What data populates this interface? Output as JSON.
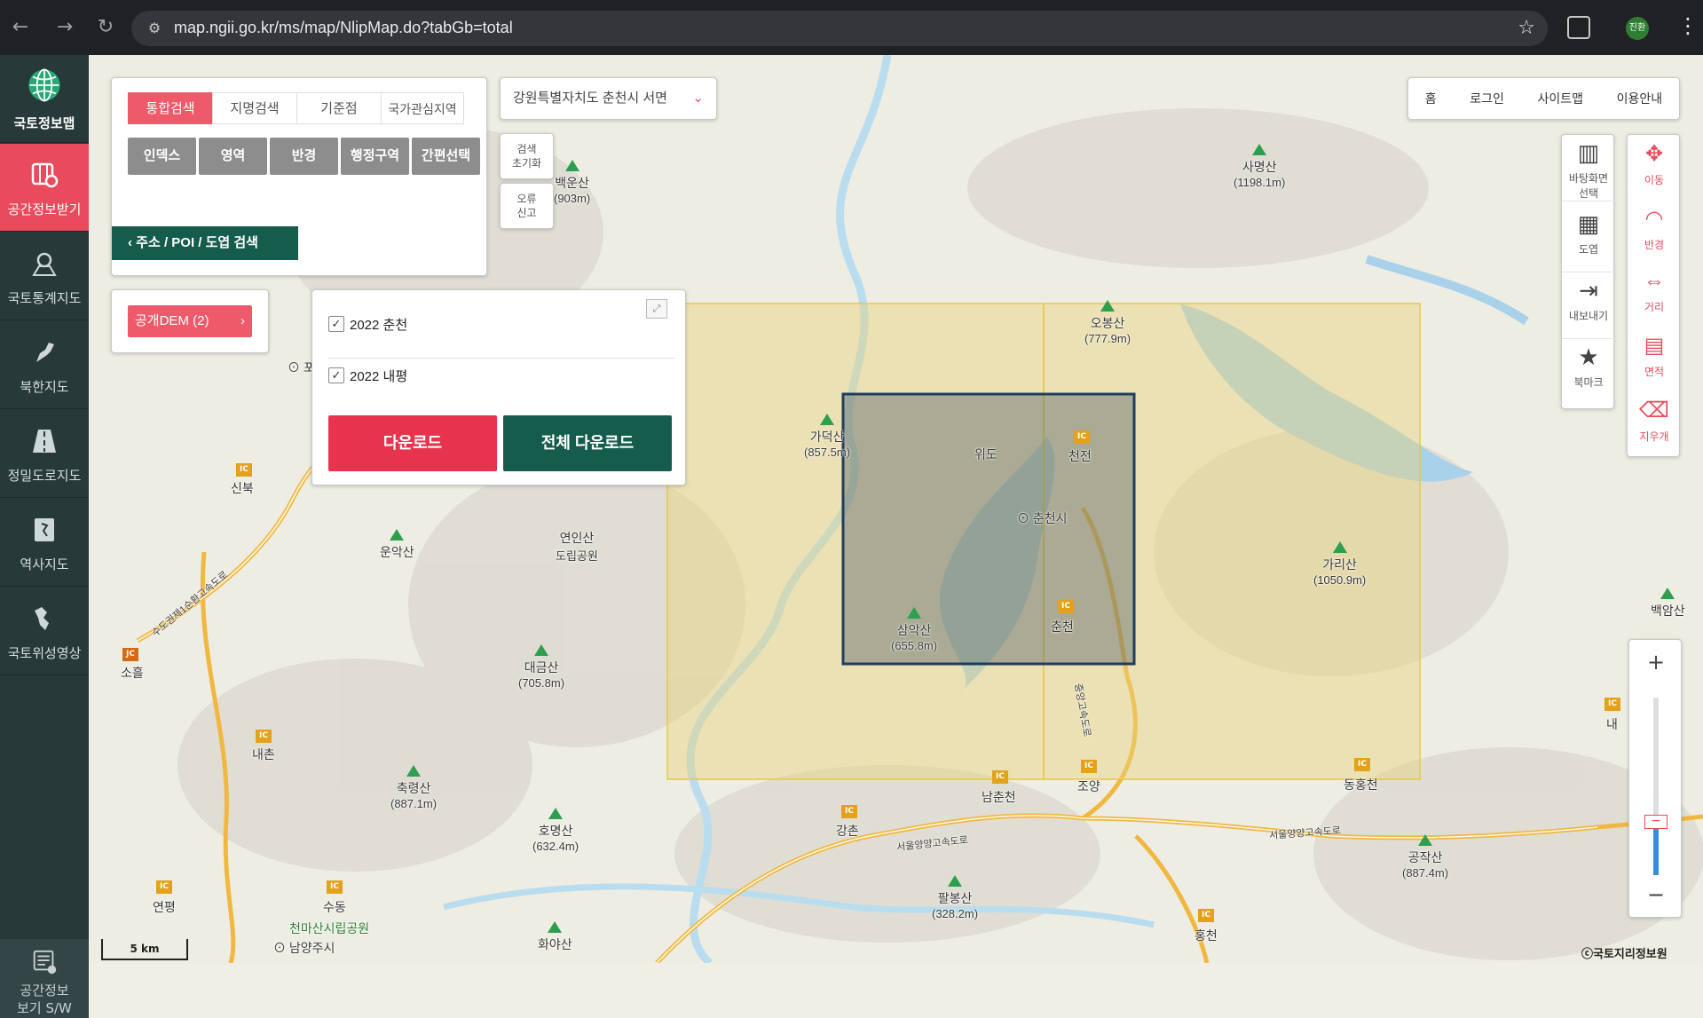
{
  "browser": {
    "url": "map.ngii.go.kr/ms/map/NlipMap.do?tabGb=total",
    "profile_initials": "진환"
  },
  "sidebar": {
    "items": [
      {
        "label": "국토정보맵",
        "icon": "globe-icon"
      },
      {
        "label": "공간정보받기",
        "icon": "map-download-icon"
      },
      {
        "label": "국토통계지도",
        "icon": "stat-map-icon"
      },
      {
        "label": "북한지도",
        "icon": "north-korea-icon"
      },
      {
        "label": "정밀도로지도",
        "icon": "road-icon"
      },
      {
        "label": "역사지도",
        "icon": "history-map-icon"
      },
      {
        "label": "국토위성영상",
        "icon": "satellite-icon"
      }
    ],
    "bottom": {
      "label_line1": "공간정보",
      "label_line2": "보기 S/W"
    }
  },
  "search_panel": {
    "tabs": [
      "통합검색",
      "지명검색",
      "기준점",
      "국가관심지역"
    ],
    "tools": [
      "인덱스",
      "영역",
      "반경",
      "행정구역",
      "간편선택"
    ],
    "address_search": "주소 / POI / 도엽 검색"
  },
  "dem": {
    "label": "공개DEM (2)"
  },
  "download_panel": {
    "items": [
      {
        "label": "2022 춘천",
        "checked": true
      },
      {
        "label": "2022 내평",
        "checked": true
      }
    ],
    "download_label": "다운로드",
    "download_all_label": "전체 다운로드"
  },
  "region_select": {
    "value": "강원특별자치도 춘천시 서면"
  },
  "small_buttons": {
    "reset": {
      "line1": "검색",
      "line2": "초기화"
    },
    "report": {
      "line1": "오류",
      "line2": "신고"
    }
  },
  "top_links": [
    "홈",
    "로그인",
    "사이트맵",
    "이용안내"
  ],
  "map_tools": [
    {
      "line1": "바탕화면",
      "line2": "선택",
      "icon": "basemap-icon"
    },
    {
      "line1": "도엽",
      "line2": "",
      "icon": "grid-icon"
    },
    {
      "line1": "내보내기",
      "line2": "",
      "icon": "export-icon"
    },
    {
      "line1": "북마크",
      "line2": "",
      "icon": "star-icon"
    }
  ],
  "measure_tools": [
    {
      "label": "이동",
      "icon": "move-icon"
    },
    {
      "label": "반경",
      "icon": "radius-icon"
    },
    {
      "label": "거리",
      "icon": "distance-icon"
    },
    {
      "label": "면적",
      "icon": "area-icon"
    },
    {
      "label": "지우개",
      "icon": "eraser-icon"
    }
  ],
  "zoom": {
    "plus": "+",
    "minus": "−",
    "level_fraction": 0.3
  },
  "map": {
    "scale_label": "5 km",
    "copyright": "ⓒ국토지리정보원",
    "places": [
      {
        "name": "백운산",
        "sub": "(903m)",
        "mtn": true
      },
      {
        "name": "사명산",
        "sub": "(1198.1m)",
        "mtn": true
      },
      {
        "name": "오봉산",
        "sub": "(777.9m)",
        "mtn": true
      },
      {
        "name": "가덕산",
        "sub": "(857.5m)",
        "mtn": true
      },
      {
        "name": "위도",
        "sub": "",
        "mtn": false
      },
      {
        "name": "천전",
        "sub": "",
        "mtn": false
      },
      {
        "name": "춘천시",
        "sub": "",
        "mtn": false
      },
      {
        "name": "가리산",
        "sub": "(1050.9m)",
        "mtn": true
      },
      {
        "name": "신북",
        "sub": "",
        "mtn": false
      },
      {
        "name": "운악산",
        "sub": "",
        "mtn": true
      },
      {
        "name": "연인산",
        "sub": "도립공원",
        "mtn": false
      },
      {
        "name": "삼악산",
        "sub": "(655.8m)",
        "mtn": true
      },
      {
        "name": "춘천",
        "sub": "",
        "mtn": false
      },
      {
        "name": "백암산",
        "sub": "",
        "mtn": true
      },
      {
        "name": "소흘",
        "sub": "",
        "mtn": false
      },
      {
        "name": "대금산",
        "sub": "(705.8m)",
        "mtn": true
      },
      {
        "name": "내촌",
        "sub": "",
        "mtn": false
      },
      {
        "name": "축령산",
        "sub": "(887.1m)",
        "mtn": true
      },
      {
        "name": "호명산",
        "sub": "(632.4m)",
        "mtn": true
      },
      {
        "name": "강촌",
        "sub": "",
        "mtn": false
      },
      {
        "name": "남춘천",
        "sub": "",
        "mtn": false
      },
      {
        "name": "조양",
        "sub": "",
        "mtn": false
      },
      {
        "name": "동홍천",
        "sub": "",
        "mtn": false
      },
      {
        "name": "공작산",
        "sub": "(887.4m)",
        "mtn": true
      },
      {
        "name": "연평",
        "sub": "",
        "mtn": false
      },
      {
        "name": "수동",
        "sub": "",
        "mtn": false
      },
      {
        "name": "천마산시립공원",
        "sub": "",
        "mtn": false
      },
      {
        "name": "팔봉산",
        "sub": "(328.2m)",
        "mtn": true
      },
      {
        "name": "남양주시",
        "sub": "",
        "mtn": false
      },
      {
        "name": "화야산",
        "sub": "",
        "mtn": true
      },
      {
        "name": "홍천",
        "sub": "",
        "mtn": false
      },
      {
        "name": "내",
        "sub": "",
        "mtn": false
      },
      {
        "name": "포",
        "sub": "",
        "mtn": false
      }
    ],
    "ic_label": "IC",
    "jc_label": "JC",
    "highway_labels": [
      "서울양양고속도로",
      "서울양양고속도로",
      "수도권제1순환고속도로",
      "중앙고속도로"
    ]
  },
  "colors": {
    "accent": "#e94a5c",
    "dark_green": "#165c4c",
    "sidebar": "#28393a",
    "selection_fill": "#e9d27a",
    "selection_box": "#1f3d5c"
  }
}
